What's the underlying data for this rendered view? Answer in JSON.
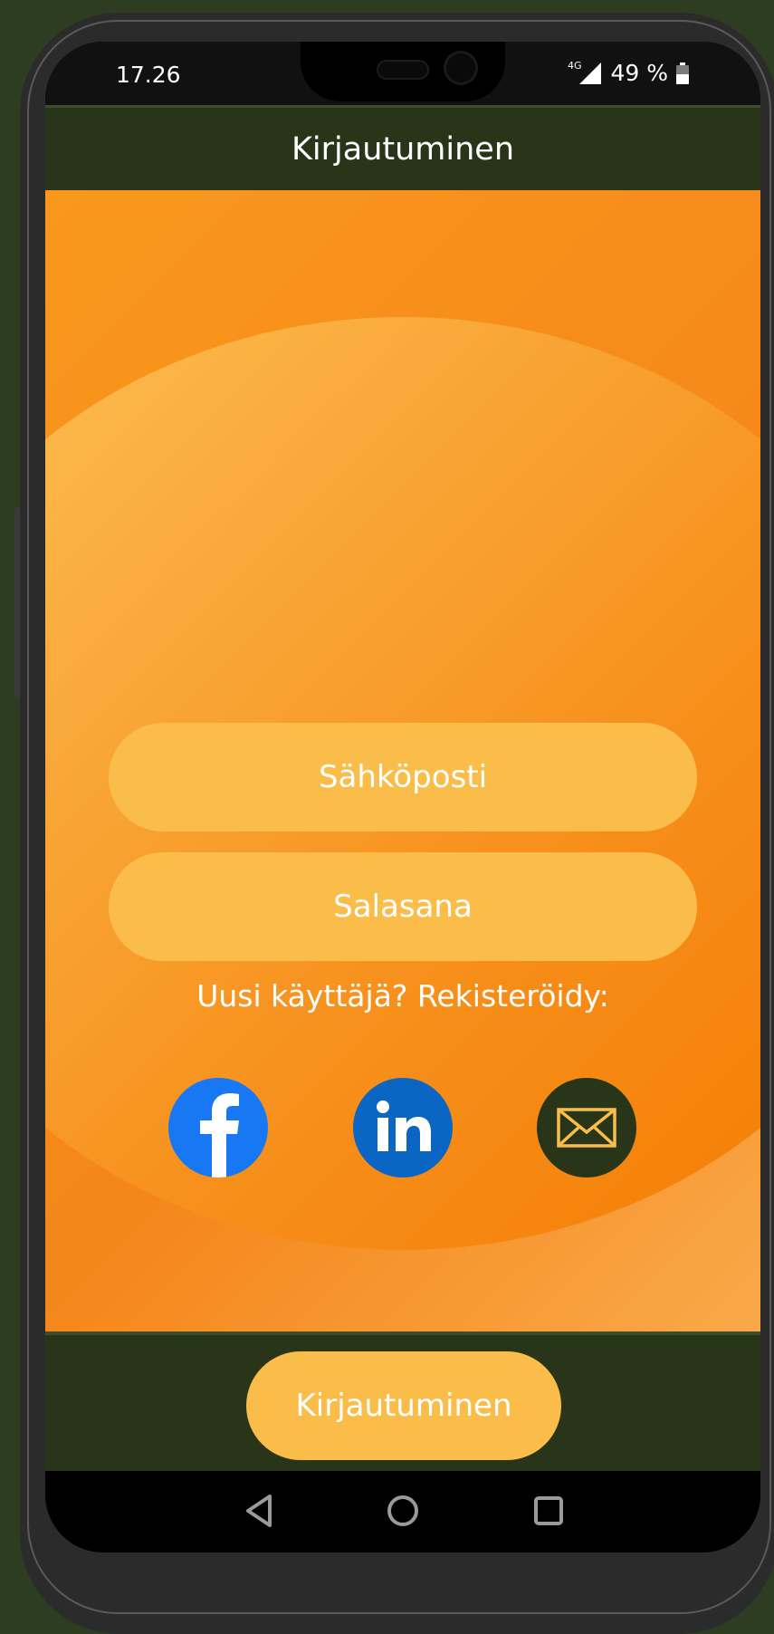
{
  "status_bar": {
    "time": "17.26",
    "network": "4G",
    "battery": "49 %",
    "signal_icon": "cell-signal-icon",
    "battery_icon": "battery-icon"
  },
  "app_bar": {
    "title": "Kirjautuminen"
  },
  "form": {
    "email_placeholder": "Sähköposti",
    "password_placeholder": "Salasana",
    "email_value": "",
    "password_value": ""
  },
  "register": {
    "label": "Uusi käyttäjä? Rekisteröidy:",
    "options": [
      {
        "icon": "facebook-icon",
        "color": "#1877f2"
      },
      {
        "icon": "linkedin-icon",
        "color": "#0a66c2"
      },
      {
        "icon": "mail-icon",
        "color": "#283518"
      }
    ]
  },
  "bottom": {
    "login_label": "Kirjautuminen"
  },
  "nav": {
    "back_icon": "back-icon",
    "home_icon": "home-icon",
    "recents_icon": "recents-icon"
  },
  "colors": {
    "dark_green": "#283518",
    "orange": "#f7901c",
    "button_yellow": "#fbbd4a"
  }
}
